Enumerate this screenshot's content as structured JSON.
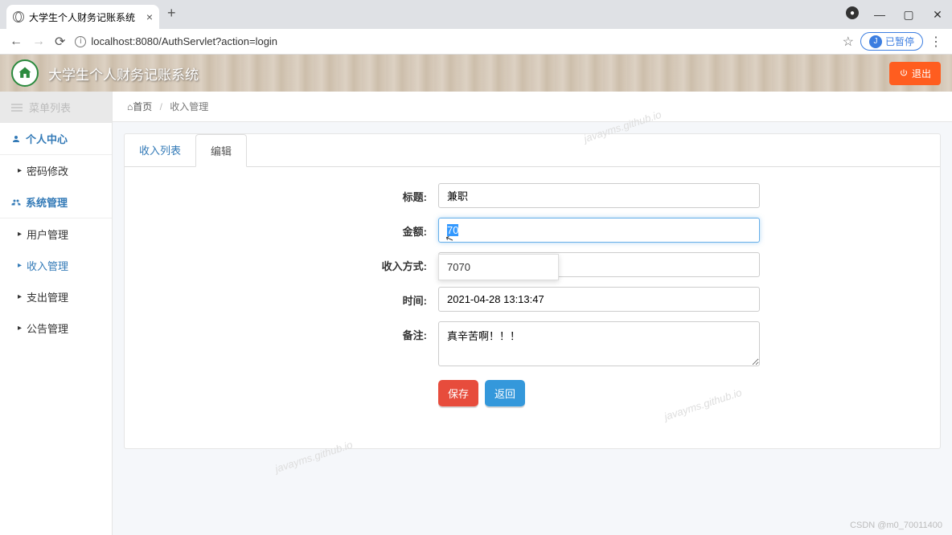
{
  "browser": {
    "tab_title": "大学生个人财务记账系统",
    "url": "localhost:8080/AuthServlet?action=login",
    "profile_badge": "J",
    "profile_text": "已暂停",
    "new_tab": "+"
  },
  "header": {
    "title": "大学生个人财务记账系统",
    "logout": "退出"
  },
  "sidebar": {
    "head": "菜单列表",
    "items": [
      {
        "label": "个人中心",
        "type": "primary"
      },
      {
        "label": "密码修改",
        "type": "sub"
      },
      {
        "label": "系统管理",
        "type": "primary"
      },
      {
        "label": "用户管理",
        "type": "sub"
      },
      {
        "label": "收入管理",
        "type": "sub",
        "active": true
      },
      {
        "label": "支出管理",
        "type": "sub"
      },
      {
        "label": "公告管理",
        "type": "sub"
      }
    ]
  },
  "breadcrumb": {
    "home_icon": "⌂",
    "home": "首页",
    "current": "收入管理"
  },
  "tabs": {
    "list": "收入列表",
    "edit": "编辑"
  },
  "form": {
    "title_label": "标题:",
    "title_value": "兼职",
    "amount_label": "金额:",
    "amount_value": "70",
    "method_label": "收入方式:",
    "method_value": "",
    "time_label": "时间:",
    "time_value": "2021-04-28 13:13:47",
    "note_label": "备注:",
    "note_value": "真辛苦啊！！！",
    "save": "保存",
    "back": "返回"
  },
  "autocomplete": {
    "suggestion_0": "7070"
  },
  "watermark": "javayms.github.io",
  "footer_watermark": "CSDN @m0_70011400"
}
